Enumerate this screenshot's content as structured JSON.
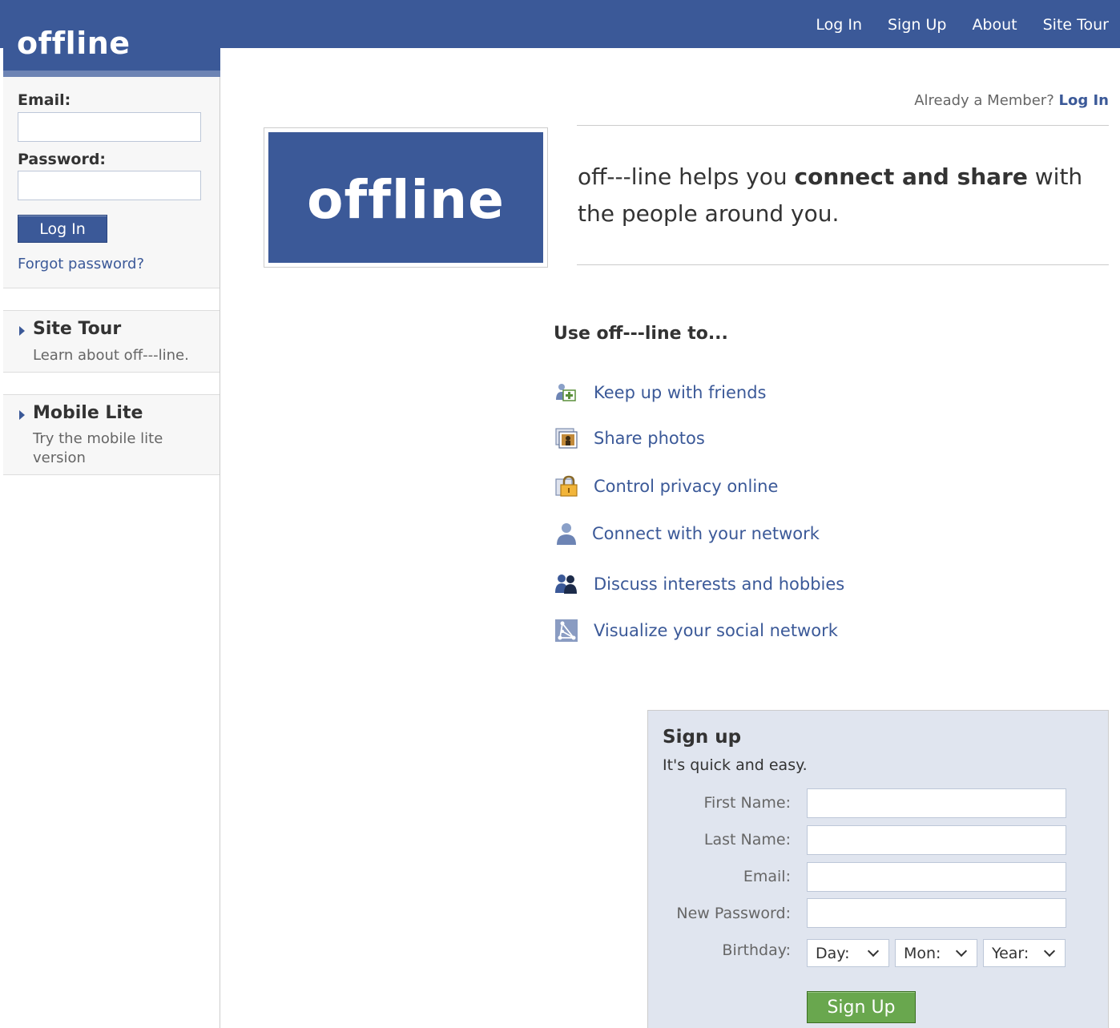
{
  "brand": {
    "logo": "offline",
    "big_logo": "offline"
  },
  "topnav": {
    "items": [
      "Log In",
      "Sign Up",
      "About",
      "Site Tour"
    ]
  },
  "login": {
    "email_label": "Email:",
    "password_label": "Password:",
    "email_value": "",
    "password_value": "",
    "button": "Log In",
    "forgot": "Forgot password?"
  },
  "sidebar": {
    "cards": [
      {
        "title": "Site Tour",
        "desc": "Learn about off---line."
      },
      {
        "title": "Mobile Lite",
        "desc": "Try the mobile lite version"
      }
    ]
  },
  "main": {
    "already_text": "Already a Member?",
    "already_link": "Log In",
    "tagline_pre": "off---line helps you ",
    "tagline_bold": "connect and share",
    "tagline_post": " with the people around you.",
    "use_heading": "Use off---line to...",
    "features": [
      {
        "icon": "friends-add-icon",
        "text": "Keep up with friends"
      },
      {
        "icon": "photos-icon",
        "text": "Share photos"
      },
      {
        "icon": "lock-icon",
        "text": "Control privacy online"
      },
      {
        "icon": "person-icon",
        "text": "Connect with your network"
      },
      {
        "icon": "group-icon",
        "text": "Discuss interests and hobbies"
      },
      {
        "icon": "network-graph-icon",
        "text": "Visualize your social network"
      }
    ]
  },
  "signup": {
    "title": "Sign up",
    "subtitle": "It's quick and easy.",
    "first_name_label": "First Name:",
    "last_name_label": "Last Name:",
    "email_label": "Email:",
    "password_label": "New Password:",
    "birthday_label": "Birthday:",
    "day": "Day:",
    "month": "Mon:",
    "year": "Year:",
    "button": "Sign Up"
  },
  "colors": {
    "brand_blue": "#3b5998",
    "signup_bg": "#e0e5ef",
    "signup_green": "#69a74e"
  }
}
